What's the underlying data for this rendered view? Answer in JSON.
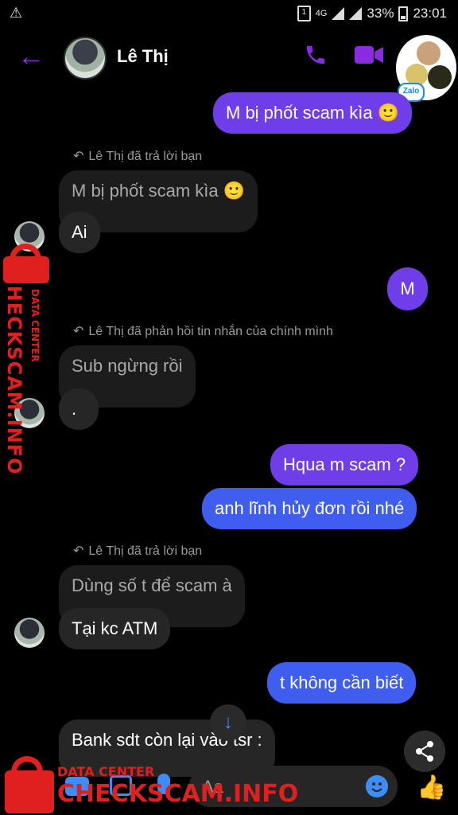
{
  "status": {
    "warning": "⚠",
    "sim": "1",
    "net": "4G",
    "battery": "33%",
    "time": "23:01"
  },
  "header": {
    "title": "Lê Thị",
    "back_icon": "←"
  },
  "chathead": {
    "badge": "Zalo"
  },
  "messages": {
    "m1": "M bị phốt scam kìa 🙂",
    "note1": "Lê Thị đã trả lời bạn",
    "q1": "M bị phốt scam kìa 🙂",
    "m2": "Ai",
    "m3": "M",
    "note2": "Lê Thị đã phản hồi tin nhắn của chính mình",
    "q2": "Sub ngừng rồi",
    "m4": ".",
    "m5": "Hqua m scam ?",
    "m6": "anh lĩnh hủy đơn rồi nhé",
    "note3": "Lê Thị đã trả lời bạn",
    "q3": "Dùng số t để scam à",
    "m7": "Tại kc ATM",
    "m8": "t không cần biết",
    "m9": "Bank sdt còn lại vào tsr :"
  },
  "watermark": {
    "small": "DATA CENTER",
    "big": "CHECKSCAM.INFO"
  },
  "composer": {
    "placeholder": "Aa"
  },
  "colors": {
    "accent": "#8a2be2",
    "outgoing": "#6f3ee8",
    "outgoing_blue": "#3f5ef0",
    "incoming": "#262626",
    "watermark": "#e0201e",
    "messenger_blue": "#3e8df5"
  }
}
